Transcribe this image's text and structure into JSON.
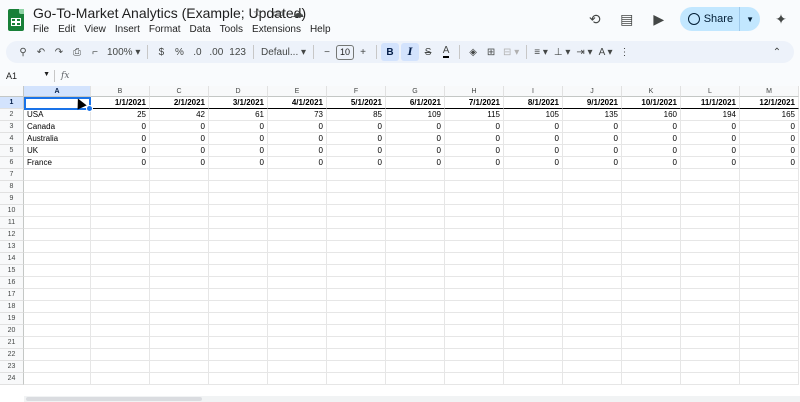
{
  "title": "Go-To-Market Analytics (Example; Updated)",
  "title_icons": [
    "star-icon",
    "folder-icon",
    "cloud-icon"
  ],
  "menus": [
    "File",
    "Edit",
    "View",
    "Insert",
    "Format",
    "Data",
    "Tools",
    "Extensions",
    "Help"
  ],
  "share_label": "Share",
  "toolbar": {
    "zoom": "100%",
    "currency": "$",
    "percent": "%",
    "dec_less": ".0",
    "dec_more": ".00",
    "number_format": "123",
    "font": "Defaul...",
    "font_size": "10",
    "bold": "B",
    "italic": "I",
    "strike": "S",
    "text_color": "A"
  },
  "formula_bar": {
    "name_box": "A1",
    "fx": "fx"
  },
  "columns": [
    "A",
    "B",
    "C",
    "D",
    "E",
    "F",
    "G",
    "H",
    "I",
    "J",
    "K",
    "L",
    "M"
  ],
  "row_numbers": [
    "1",
    "2",
    "3",
    "4",
    "5",
    "6",
    "7",
    "8",
    "9",
    "10",
    "11",
    "12",
    "13",
    "14",
    "15",
    "16",
    "17",
    "18",
    "19",
    "20",
    "21",
    "22",
    "23",
    "24"
  ],
  "sheet": {
    "header": [
      "",
      "1/1/2021",
      "2/1/2021",
      "3/1/2021",
      "4/1/2021",
      "5/1/2021",
      "6/1/2021",
      "7/1/2021",
      "8/1/2021",
      "9/1/2021",
      "10/1/2021",
      "11/1/2021",
      "12/1/2021"
    ],
    "rows": [
      [
        "USA",
        "25",
        "42",
        "61",
        "73",
        "85",
        "109",
        "115",
        "105",
        "135",
        "160",
        "194",
        "165"
      ],
      [
        "Canada",
        "0",
        "0",
        "0",
        "0",
        "0",
        "0",
        "0",
        "0",
        "0",
        "0",
        "0",
        "0"
      ],
      [
        "Australia",
        "0",
        "0",
        "0",
        "0",
        "0",
        "0",
        "0",
        "0",
        "0",
        "0",
        "0",
        "0"
      ],
      [
        "UK",
        "0",
        "0",
        "0",
        "0",
        "0",
        "0",
        "0",
        "0",
        "0",
        "0",
        "0",
        "0"
      ],
      [
        "France",
        "0",
        "0",
        "0",
        "0",
        "0",
        "0",
        "0",
        "0",
        "0",
        "0",
        "0",
        "0"
      ]
    ]
  },
  "selected_cell": "A1",
  "colors": {
    "accent": "#1a73e8",
    "share_bg": "#c2e7ff",
    "toolbar_bg": "#edf2fa",
    "sheets_green": "#188038"
  }
}
